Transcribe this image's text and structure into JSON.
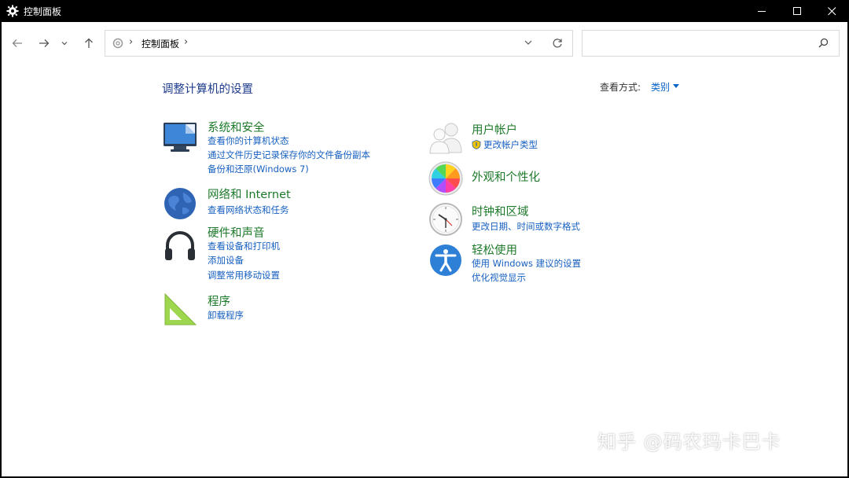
{
  "window": {
    "title": "控制面板"
  },
  "address": {
    "crumb": "控制面板"
  },
  "search": {
    "placeholder": ""
  },
  "main": {
    "heading": "调整计算机的设置",
    "view_by_label": "查看方式:",
    "view_by_value": "类别"
  },
  "categories": {
    "system": {
      "title": "系统和安全",
      "links": [
        "查看你的计算机状态",
        "通过文件历史记录保存你的文件备份副本",
        "备份和还原(Windows 7)"
      ]
    },
    "network": {
      "title": "网络和 Internet",
      "links": [
        "查看网络状态和任务"
      ]
    },
    "hardware": {
      "title": "硬件和声音",
      "links": [
        "查看设备和打印机",
        "添加设备",
        "调整常用移动设置"
      ]
    },
    "programs": {
      "title": "程序",
      "links": [
        "卸载程序"
      ]
    },
    "users": {
      "title": "用户帐户",
      "links": [
        "更改帐户类型"
      ]
    },
    "appearance": {
      "title": "外观和个性化",
      "links": []
    },
    "clock": {
      "title": "时钟和区域",
      "links": [
        "更改日期、时间或数字格式"
      ]
    },
    "ease": {
      "title": "轻松使用",
      "links": [
        "使用 Windows 建议的设置",
        "优化视觉显示"
      ]
    }
  },
  "watermark": {
    "text": "知乎 @码农玛卡巴卡"
  },
  "colors": {
    "title_green": "#1d7a2a",
    "link_blue": "#1760c0",
    "heading_blue": "#1e3c8c"
  }
}
